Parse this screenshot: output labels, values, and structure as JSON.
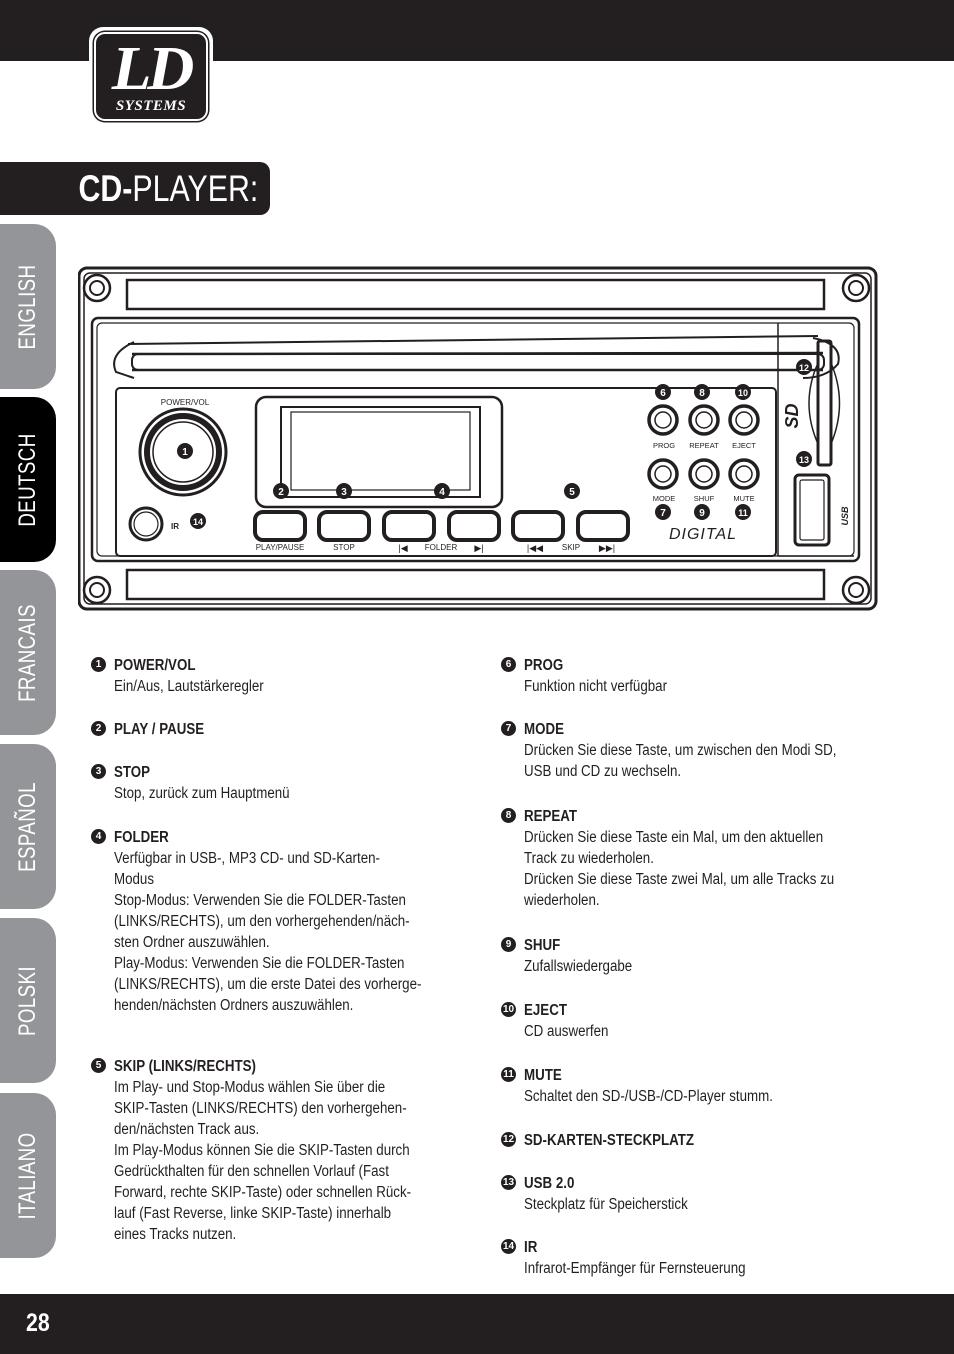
{
  "logo": {
    "brand": "LD",
    "sub": "SYSTEMS"
  },
  "title": {
    "bold": "CD-",
    "light": "PLAYER:"
  },
  "languages": [
    {
      "label": "ENGLISH",
      "active": false
    },
    {
      "label": "DEUTSCH",
      "active": true
    },
    {
      "label": "FRANCAIS",
      "active": false
    },
    {
      "label": "ESPAÑOL",
      "active": false
    },
    {
      "label": "POLSKI",
      "active": false
    },
    {
      "label": "ITALIANO",
      "active": false
    }
  ],
  "device": {
    "labels": {
      "power_vol": "POWER/VOL",
      "ir": "IR",
      "play_pause": "PLAY/PAUSE",
      "stop": "STOP",
      "folder": "FOLDER",
      "skip": "SKIP",
      "prog": "PROG",
      "repeat": "REPEAT",
      "eject": "EJECT",
      "mode": "MODE",
      "shuf": "SHUF",
      "mute": "MUTE",
      "digital": "DIGITAL",
      "sd": "SD",
      "usb": "USB"
    },
    "callouts": [
      "1",
      "2",
      "3",
      "4",
      "5",
      "6",
      "7",
      "8",
      "9",
      "10",
      "11",
      "12",
      "13",
      "14"
    ]
  },
  "items_left": [
    {
      "num": "1",
      "head": "POWER/VOL",
      "desc": "Ein/Aus, Lautstärkeregler"
    },
    {
      "num": "2",
      "head": "PLAY / PAUSE",
      "desc": ""
    },
    {
      "num": "3",
      "head": "STOP",
      "desc": "Stop, zurück zum Hauptmenü"
    },
    {
      "num": "4",
      "head": "FOLDER",
      "desc": "Verfügbar in USB-, MP3 CD- und SD-Karten-\nModus\nStop-Modus: Verwenden Sie die FOLDER-Tasten\n(LINKS/RECHTS), um den vorhergehenden/näch-\nsten Ordner auszuwählen.\nPlay-Modus: Verwenden Sie die FOLDER-Tasten\n(LINKS/RECHTS), um die erste Datei des vorherge-\nhenden/nächsten Ordners auszuwählen."
    },
    {
      "num": "5",
      "head": "SKIP  (LINKS/RECHTS)",
      "desc": "Im Play- und Stop-Modus wählen Sie über die\nSKIP-Tasten (LINKS/RECHTS) den vorhergehen-\nden/nächsten Track aus.\nIm Play-Modus können Sie die SKIP-Tasten durch\nGedrückthalten für den schnellen Vorlauf (Fast\nForward, rechte SKIP-Taste) oder schnellen Rück-\nlauf (Fast Reverse, linke SKIP-Taste) innerhalb\neines Tracks nutzen."
    }
  ],
  "items_right": [
    {
      "num": "6",
      "head": "PROG",
      "desc": "Funktion nicht verfügbar"
    },
    {
      "num": "7",
      "head": "MODE",
      "desc": "Drücken Sie diese Taste, um zwischen den Modi SD,\nUSB und CD zu wechseln."
    },
    {
      "num": "8",
      "head": "REPEAT",
      "desc": "Drücken Sie diese Taste ein Mal, um den aktuellen\nTrack zu wiederholen.\nDrücken Sie diese Taste zwei Mal, um alle Tracks zu\nwiederholen."
    },
    {
      "num": "9",
      "head": "SHUF",
      "desc": "Zufallswiedergabe"
    },
    {
      "num": "10",
      "head": "EJECT",
      "desc": "CD auswerfen"
    },
    {
      "num": "11",
      "head": "MUTE",
      "desc": "Schaltet den SD-/USB-/CD-Player stumm."
    },
    {
      "num": "12",
      "head": "SD-KARTEN-STECKPLATZ",
      "desc": ""
    },
    {
      "num": "13",
      "head": "USB 2.0",
      "desc": "Steckplatz für Speicherstick"
    },
    {
      "num": "14",
      "head": "IR",
      "desc": "Infrarot-Empfänger für Fernsteuerung"
    }
  ],
  "page_number": "28"
}
